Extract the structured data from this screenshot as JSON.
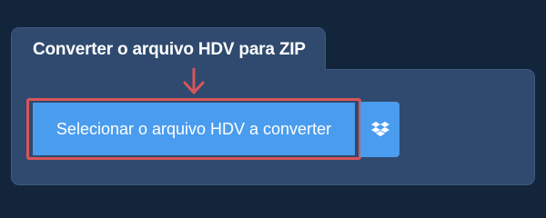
{
  "panel": {
    "title": "Converter o arquivo HDV para ZIP"
  },
  "upload": {
    "select_button_label": "Selecionar o arquivo HDV a converter",
    "dropbox_icon": "dropbox-icon"
  },
  "colors": {
    "background": "#13253a",
    "panel": "#2f4a6e",
    "button": "#4a9cef",
    "highlight": "#d9545a"
  }
}
